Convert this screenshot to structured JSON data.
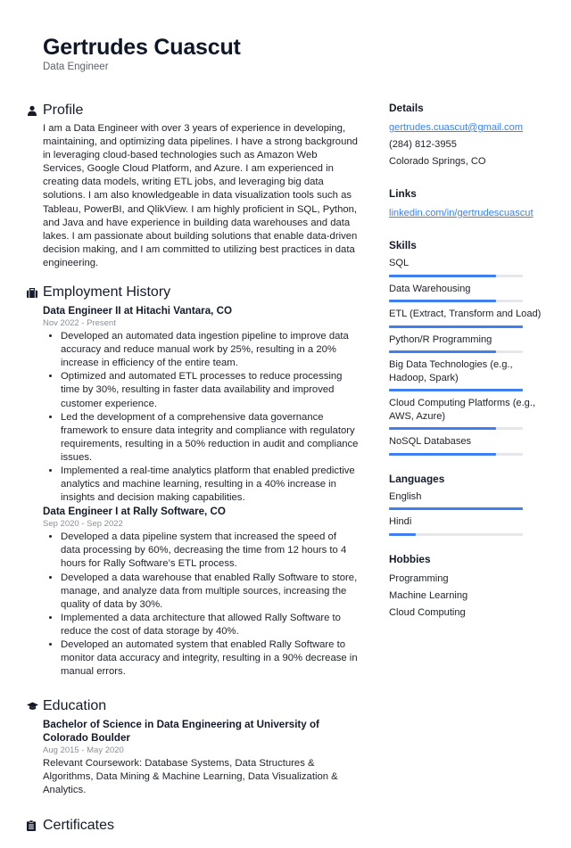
{
  "header": {
    "name": "Gertrudes Cuascut",
    "title": "Data Engineer"
  },
  "profile": {
    "heading": "Profile",
    "icon": "person-icon",
    "text": "I am a Data Engineer with over 3 years of experience in developing, maintaining, and optimizing data pipelines. I have a strong background in leveraging cloud-based technologies such as Amazon Web Services, Google Cloud Platform, and Azure. I am experienced in creating data models, writing ETL jobs, and leveraging big data solutions. I am also knowledgeable in data visualization tools such as Tableau, PowerBI, and QlikView. I am highly proficient in SQL, Python, and Java and have experience in building data warehouses and data lakes. I am passionate about building solutions that enable data-driven decision making, and I am committed to utilizing best practices in data engineering."
  },
  "employment": {
    "heading": "Employment History",
    "icon": "briefcase-icon",
    "jobs": [
      {
        "title": "Data Engineer II at Hitachi Vantara, CO",
        "dates": "Nov 2022 - Present",
        "bullets": [
          "Developed an automated data ingestion pipeline to improve data accuracy and reduce manual work by 25%, resulting in a 20% increase in efficiency of the entire team.",
          "Optimized and automated ETL processes to reduce processing time by 30%, resulting in faster data availability and improved customer experience.",
          "Led the development of a comprehensive data governance framework to ensure data integrity and compliance with regulatory requirements, resulting in a 50% reduction in audit and compliance issues.",
          "Implemented a real-time analytics platform that enabled predictive analytics and machine learning, resulting in a 40% increase in insights and decision making capabilities."
        ]
      },
      {
        "title": "Data Engineer I at Rally Software, CO",
        "dates": "Sep 2020 - Sep 2022",
        "bullets": [
          "Developed a data pipeline system that increased the speed of data processing by 60%, decreasing the time from 12 hours to 4 hours for Rally Software’s ETL process.",
          "Developed a data warehouse that enabled Rally Software to store, manage, and analyze data from multiple sources, increasing the quality of data by 30%.",
          "Implemented a data architecture that allowed Rally Software to reduce the cost of data storage by 40%.",
          "Developed an automated system that enabled Rally Software to monitor data accuracy and integrity, resulting in a 90% decrease in manual errors."
        ]
      }
    ]
  },
  "education": {
    "heading": "Education",
    "icon": "graduation-cap-icon",
    "degree": "Bachelor of Science in Data Engineering at University of Colorado Boulder",
    "dates": "Aug 2015 - May 2020",
    "text": "Relevant Coursework: Database Systems, Data Structures & Algorithms, Data Mining & Machine Learning, Data Visualization & Analytics."
  },
  "certificates": {
    "heading": "Certificates",
    "icon": "clipboard-icon"
  },
  "details": {
    "heading": "Details",
    "email": "gertrudes.cuascut@gmail.com",
    "phone": "(284) 812-3955",
    "location": "Colorado Springs, CO"
  },
  "links": {
    "heading": "Links",
    "items": [
      "linkedin.com/in/gertrudescuascut"
    ]
  },
  "skills": {
    "heading": "Skills",
    "items": [
      {
        "label": "SQL",
        "level": 0.8
      },
      {
        "label": "Data Warehousing",
        "level": 0.8
      },
      {
        "label": "ETL (Extract, Transform and Load)",
        "level": 1.0
      },
      {
        "label": "Python/R Programming",
        "level": 0.8
      },
      {
        "label": "Big Data Technologies (e.g., Hadoop, Spark)",
        "level": 1.0
      },
      {
        "label": "Cloud Computing Platforms (e.g., AWS, Azure)",
        "level": 0.8
      },
      {
        "label": "NoSQL Databases",
        "level": 0.8
      }
    ]
  },
  "languages": {
    "heading": "Languages",
    "items": [
      {
        "label": "English",
        "level": 1.0
      },
      {
        "label": "Hindi",
        "level": 0.2
      }
    ]
  },
  "hobbies": {
    "heading": "Hobbies",
    "items": [
      "Programming",
      "Machine Learning",
      "Cloud Computing"
    ]
  },
  "colors": {
    "accent": "#3f7ff0",
    "track": "#e5e7eb",
    "link": "#3b82f6"
  }
}
